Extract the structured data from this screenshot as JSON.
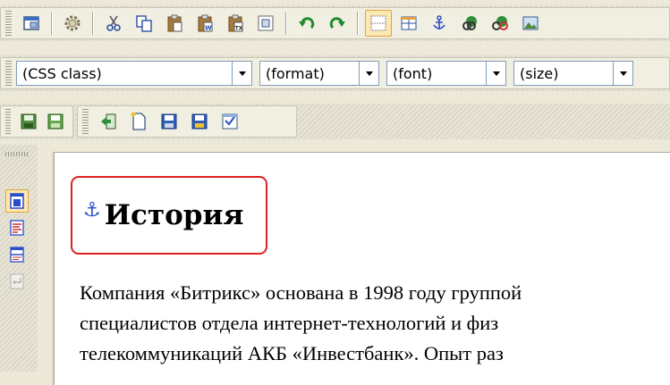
{
  "toolbar_row1": {
    "buttons": [
      {
        "name": "full-screen-button",
        "icon": "window-icon"
      },
      {
        "name": "settings-button",
        "icon": "gear-icon"
      },
      {
        "name": "cut-button",
        "icon": "scissors-icon"
      },
      {
        "name": "copy-button",
        "icon": "copy-icon"
      },
      {
        "name": "paste-button",
        "icon": "paste-icon"
      },
      {
        "name": "paste-word-button",
        "icon": "paste-word-icon"
      },
      {
        "name": "paste-text-button",
        "icon": "paste-text-icon"
      },
      {
        "name": "paste-special-button",
        "icon": "paste-special-icon"
      },
      {
        "name": "undo-button",
        "icon": "undo-icon"
      },
      {
        "name": "redo-button",
        "icon": "redo-icon"
      },
      {
        "name": "show-borders-button",
        "icon": "borders-icon"
      },
      {
        "name": "table-button",
        "icon": "table-icon"
      },
      {
        "name": "anchor-button",
        "icon": "anchor-icon"
      },
      {
        "name": "link-button",
        "icon": "link-icon"
      },
      {
        "name": "unlink-button",
        "icon": "unlink-icon"
      },
      {
        "name": "image-button",
        "icon": "image-icon"
      }
    ]
  },
  "toolbar_row2": {
    "css_class": {
      "value": "(CSS class)"
    },
    "format": {
      "value": "(format)"
    },
    "font": {
      "value": "(font)"
    },
    "size": {
      "value": "(size)"
    }
  },
  "toolbar_row3": {
    "buttons": [
      {
        "name": "save-button",
        "icon": "save-icon"
      },
      {
        "name": "save-as-button",
        "icon": "save-green-icon"
      },
      {
        "name": "exit-button",
        "icon": "exit-icon"
      },
      {
        "name": "new-page-button",
        "icon": "new-page-icon"
      },
      {
        "name": "save-page-button",
        "icon": "floppy-icon"
      },
      {
        "name": "save-page-as-button",
        "icon": "floppy-star-icon"
      },
      {
        "name": "page-properties-button",
        "icon": "properties-icon"
      }
    ]
  },
  "sidebar": {
    "buttons": [
      {
        "name": "design-mode-button",
        "icon": "design-icon",
        "active": true
      },
      {
        "name": "code-mode-button",
        "icon": "code-icon",
        "active": false
      },
      {
        "name": "split-mode-button",
        "icon": "split-icon",
        "active": false
      },
      {
        "name": "wrap-button",
        "icon": "wrap-icon",
        "active": false
      }
    ]
  },
  "colors": {
    "accent": "#e02020",
    "anchor": "#2a4ec9",
    "active_bg": "#fde7b2",
    "active_border": "#e3a33a"
  },
  "editor": {
    "heading_icon": "anchor-icon",
    "heading": "История",
    "lines": [
      "Компания «Битрикс» основана в 1998 году группой",
      "специалистов отдела интернет-технологий и физ",
      "телекоммуникаций АКБ «Инвестбанк». Опыт раз"
    ]
  }
}
